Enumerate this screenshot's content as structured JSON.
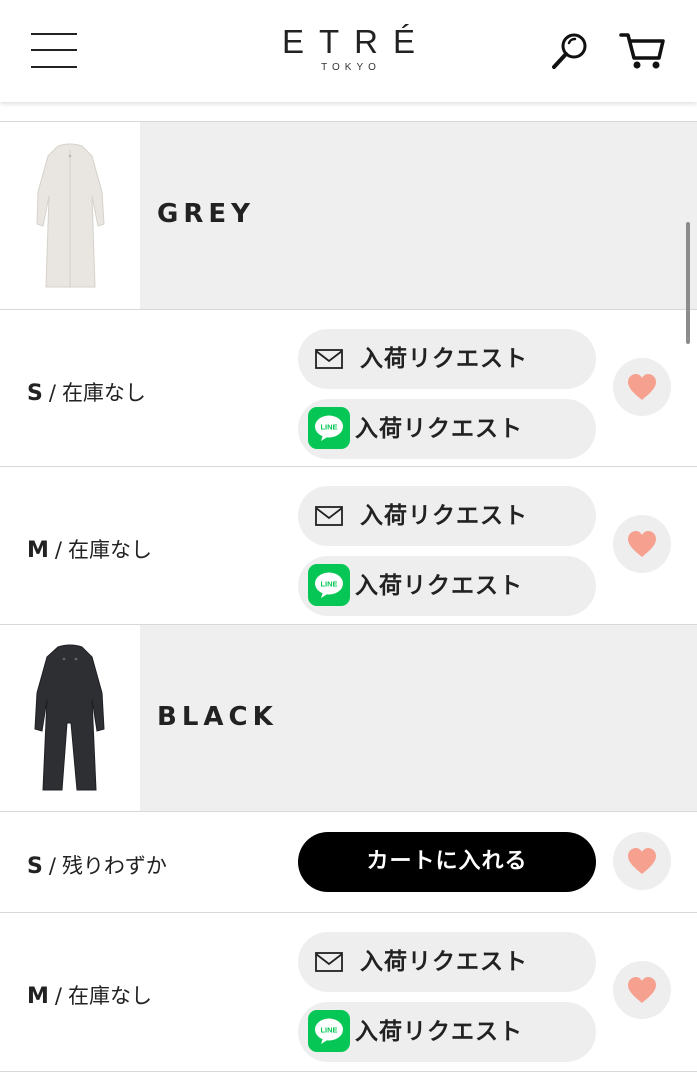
{
  "brand": {
    "name": "ETRÉ",
    "sub": "TOKYO"
  },
  "colors": [
    {
      "name": "GREY",
      "sizes": [
        {
          "size": "S",
          "status": "在庫なし",
          "mail_label": "入荷リクエスト",
          "line_label": "入荷リクエスト"
        },
        {
          "size": "M",
          "status": "在庫なし",
          "mail_label": "入荷リクエスト",
          "line_label": "入荷リクエスト"
        }
      ]
    },
    {
      "name": "BLACK",
      "sizes": [
        {
          "size": "S",
          "status": "残りわずか",
          "cart_label": "カートに入れる"
        },
        {
          "size": "M",
          "status": "在庫なし",
          "mail_label": "入荷リクエスト",
          "line_label": "入荷リクエスト"
        }
      ]
    }
  ],
  "icons": {
    "line_text": "LINE",
    "line_green": "#06c755",
    "heart_color": "#f6a190",
    "menu": "hamburger-icon",
    "search": "search-icon",
    "cart": "cart-icon"
  }
}
